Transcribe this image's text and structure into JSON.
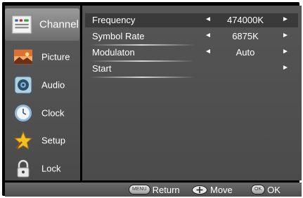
{
  "sidebar": {
    "items": [
      {
        "label": "Channel",
        "icon": "channel-icon",
        "active": true
      },
      {
        "label": "Picture",
        "icon": "picture-icon",
        "active": false
      },
      {
        "label": "Audio",
        "icon": "audio-icon",
        "active": false
      },
      {
        "label": "Clock",
        "icon": "clock-icon",
        "active": false
      },
      {
        "label": "Setup",
        "icon": "setup-icon",
        "active": false
      },
      {
        "label": "Lock",
        "icon": "lock-icon",
        "active": false
      }
    ]
  },
  "menu": {
    "rows": [
      {
        "label": "Frequency",
        "value": "474000K",
        "has_arrows": true,
        "selected": true
      },
      {
        "label": "Symbol Rate",
        "value": "6875K",
        "has_arrows": true,
        "selected": false
      },
      {
        "label": "Modulaton",
        "value": "Auto",
        "has_arrows": true,
        "selected": false
      },
      {
        "label": "Start",
        "value": "",
        "has_arrows": false,
        "selected": false
      }
    ],
    "left_arrow": "◄",
    "right_arrow": "►"
  },
  "footer": {
    "menu_key": "MENU",
    "return_label": "Return",
    "move_label": "Move",
    "ok_key": "OK",
    "ok_label": "OK"
  },
  "colors": {
    "background": "#000000",
    "panel": "#555555",
    "selected_row": "#3a3a3a",
    "text": "#ffffff"
  }
}
